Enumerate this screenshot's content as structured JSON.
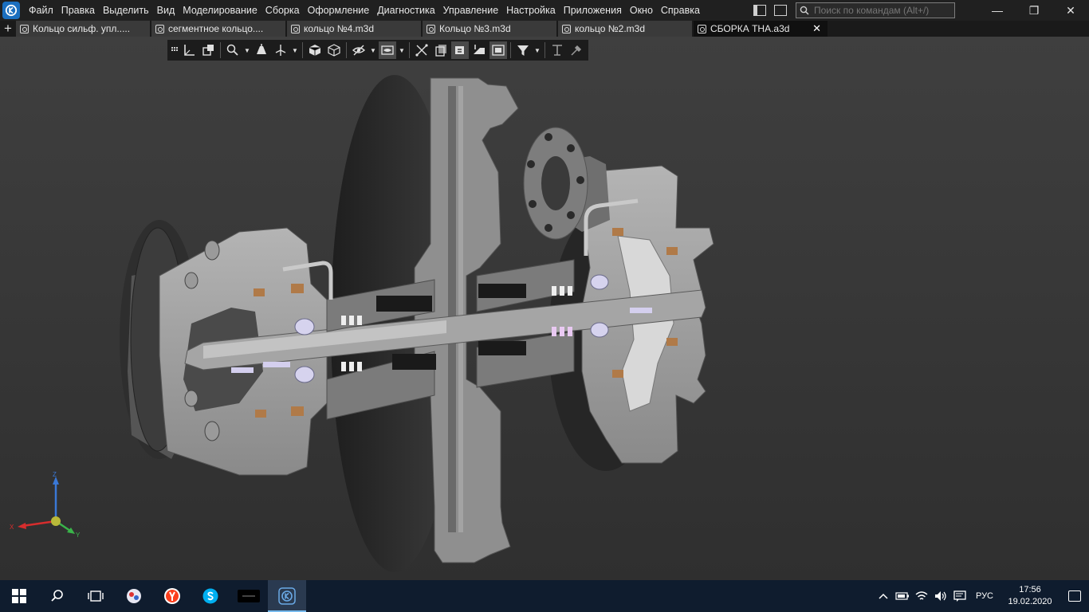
{
  "app": {
    "logo_icon": "kompas-logo-icon",
    "brand_color": "#1b6fbf"
  },
  "menu": {
    "items": [
      "Файл",
      "Правка",
      "Выделить",
      "Вид",
      "Моделирование",
      "Сборка",
      "Оформление",
      "Диагностика",
      "Управление",
      "Настройка",
      "Приложения",
      "Окно",
      "Справка"
    ]
  },
  "search": {
    "placeholder": "Поиск по командам (Alt+/)"
  },
  "window_controls": {
    "minimize": "—",
    "restore": "❐",
    "close": "✕"
  },
  "tabs": {
    "items": [
      {
        "label": "Кольцо сильф. упл.....",
        "active": false
      },
      {
        "label": "сегментное кольцо....",
        "active": false
      },
      {
        "label": "кольцо №4.m3d",
        "active": false
      },
      {
        "label": "Кольцо №3.m3d",
        "active": false
      },
      {
        "label": "кольцо №2.m3d",
        "active": false
      },
      {
        "label": "СБОРКА ТНА.a3d",
        "active": true
      }
    ],
    "add_label": "+",
    "close_label": "✕"
  },
  "viewport": {
    "toolbar_icons": [
      "grip-icon",
      "axis-frame-icon",
      "view-orient-icon",
      "zoom-icon",
      "dropdown",
      "pan-icon",
      "section-axis-icon",
      "dropdown",
      "shaded-cube-icon",
      "wireframe-cube-icon",
      "hide-eye-icon",
      "dropdown",
      "display-mode-icon",
      "dropdown",
      "perspective-icon",
      "section-view-icon",
      "layers-icon",
      "properties-icon",
      "filter-state-icon",
      "filter-icon",
      "dropdown",
      "snap-icon",
      "eyedropper-icon"
    ],
    "triad": {
      "x_label": "X",
      "y_label": "Y",
      "z_label": "Z",
      "x_color": "#d62d2d",
      "y_color": "#3ab54a",
      "z_color": "#3a78d6"
    }
  },
  "taskbar": {
    "items": [
      "windows-start-icon",
      "search-icon",
      "task-view-icon",
      "app-icon",
      "yandex-browser-icon",
      "skype-icon",
      "media-app-icon",
      "kompas-logo-icon"
    ],
    "active_index": 7,
    "tray": {
      "language": "РУС",
      "time": "17:56",
      "date": "19.02.2020"
    }
  }
}
